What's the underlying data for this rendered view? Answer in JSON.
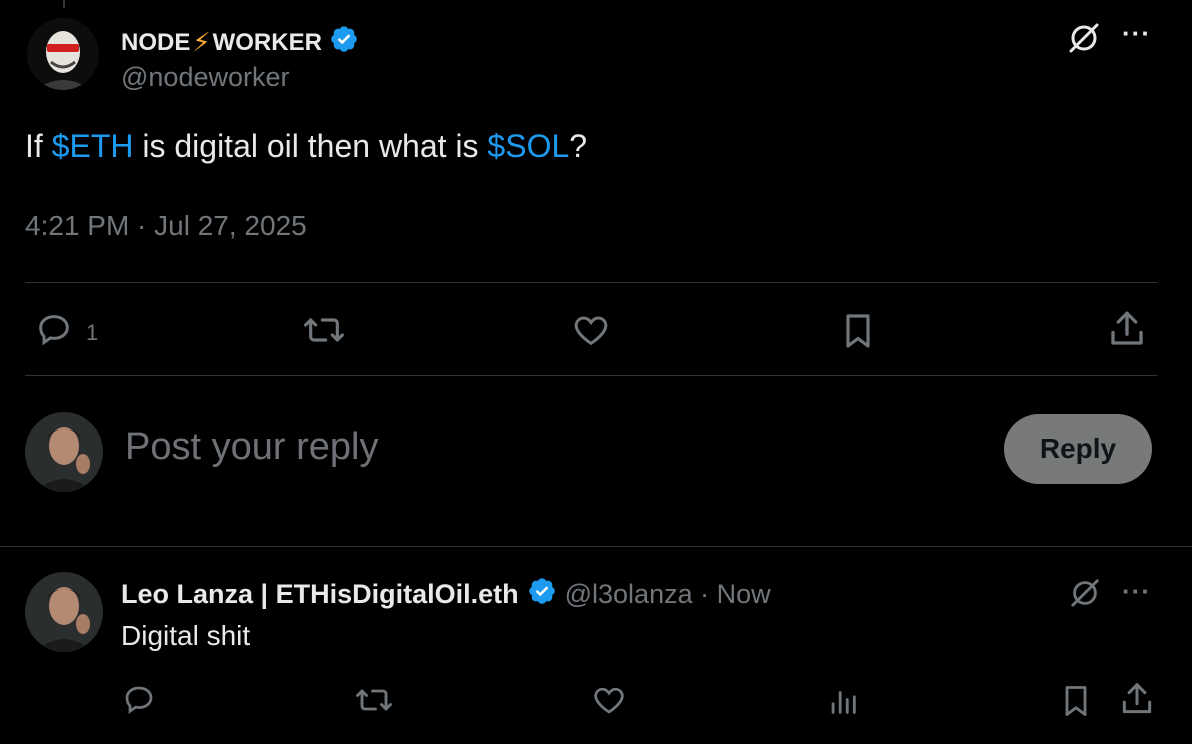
{
  "main_tweet": {
    "author_name_part1": "NODE",
    "author_name_emoji": "⚡",
    "author_name_part2": "WORKER",
    "handle": "@nodeworker",
    "text_prefix": "If ",
    "cashtag1": "$ETH",
    "text_middle": " is digital oil then what is ",
    "cashtag2": "$SOL",
    "text_suffix": "?",
    "timestamp": "4:21 PM · Jul 27, 2025",
    "reply_count": "1",
    "more_label": "···"
  },
  "composer": {
    "placeholder": "Post your reply",
    "reply_button": "Reply"
  },
  "reply_tweet": {
    "author_name": "Leo Lanza | ETHisDigitalOil.eth",
    "handle": "@l3olanza",
    "separator": " · ",
    "time": "Now",
    "text": "Digital shit",
    "more_label": "···"
  },
  "colors": {
    "background": "#000000",
    "text": "#e7e9ea",
    "muted": "#71767b",
    "link": "#1d9bf0",
    "verified": "#1d9bf0",
    "divider": "#2f3336"
  }
}
